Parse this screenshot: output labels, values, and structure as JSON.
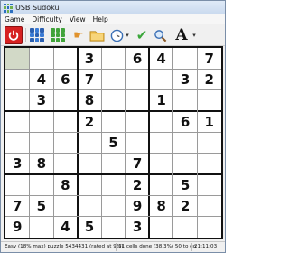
{
  "window": {
    "title": "USB Sudoku"
  },
  "menu": [
    "Game",
    "Difficulty",
    "View",
    "Help"
  ],
  "toolbar": {
    "icons": [
      "power-icon",
      "grid-icon",
      "grid-green-icon",
      "hand-icon",
      "folder-icon",
      "clock-icon",
      "checkmark-icon",
      "magnifier-icon",
      "font-icon"
    ],
    "font_glyph": "A",
    "dropdown_glyph": "▾"
  },
  "board": {
    "rows": [
      [
        "",
        "",
        "",
        "3",
        "",
        "6",
        "4",
        "",
        "7"
      ],
      [
        "",
        "4",
        "6",
        "7",
        "",
        "",
        "",
        "3",
        "2"
      ],
      [
        "",
        "3",
        "",
        "8",
        "",
        "",
        "1",
        "",
        ""
      ],
      [
        "",
        "",
        "",
        "2",
        "",
        "",
        "",
        "6",
        "1"
      ],
      [
        "",
        "",
        "",
        "",
        "5",
        "",
        "",
        "",
        ""
      ],
      [
        "3",
        "8",
        "",
        "",
        "",
        "7",
        "",
        "",
        ""
      ],
      [
        "",
        "",
        "8",
        "",
        "",
        "2",
        "",
        "5",
        ""
      ],
      [
        "7",
        "5",
        "",
        "",
        "",
        "9",
        "8",
        "2",
        ""
      ],
      [
        "9",
        "",
        "4",
        "5",
        "",
        "3",
        "",
        "",
        ""
      ]
    ],
    "selected_cell": [
      0,
      0
    ]
  },
  "status": {
    "difficulty": "Easy (18% max) puzzle 5434431 (rated at 9%)",
    "progress": "31 cells done (38.3%) 50 to go",
    "time": "21:11:03"
  },
  "colors": {
    "selected_cell": "#d2d9c7",
    "power_button": "#d62020"
  }
}
